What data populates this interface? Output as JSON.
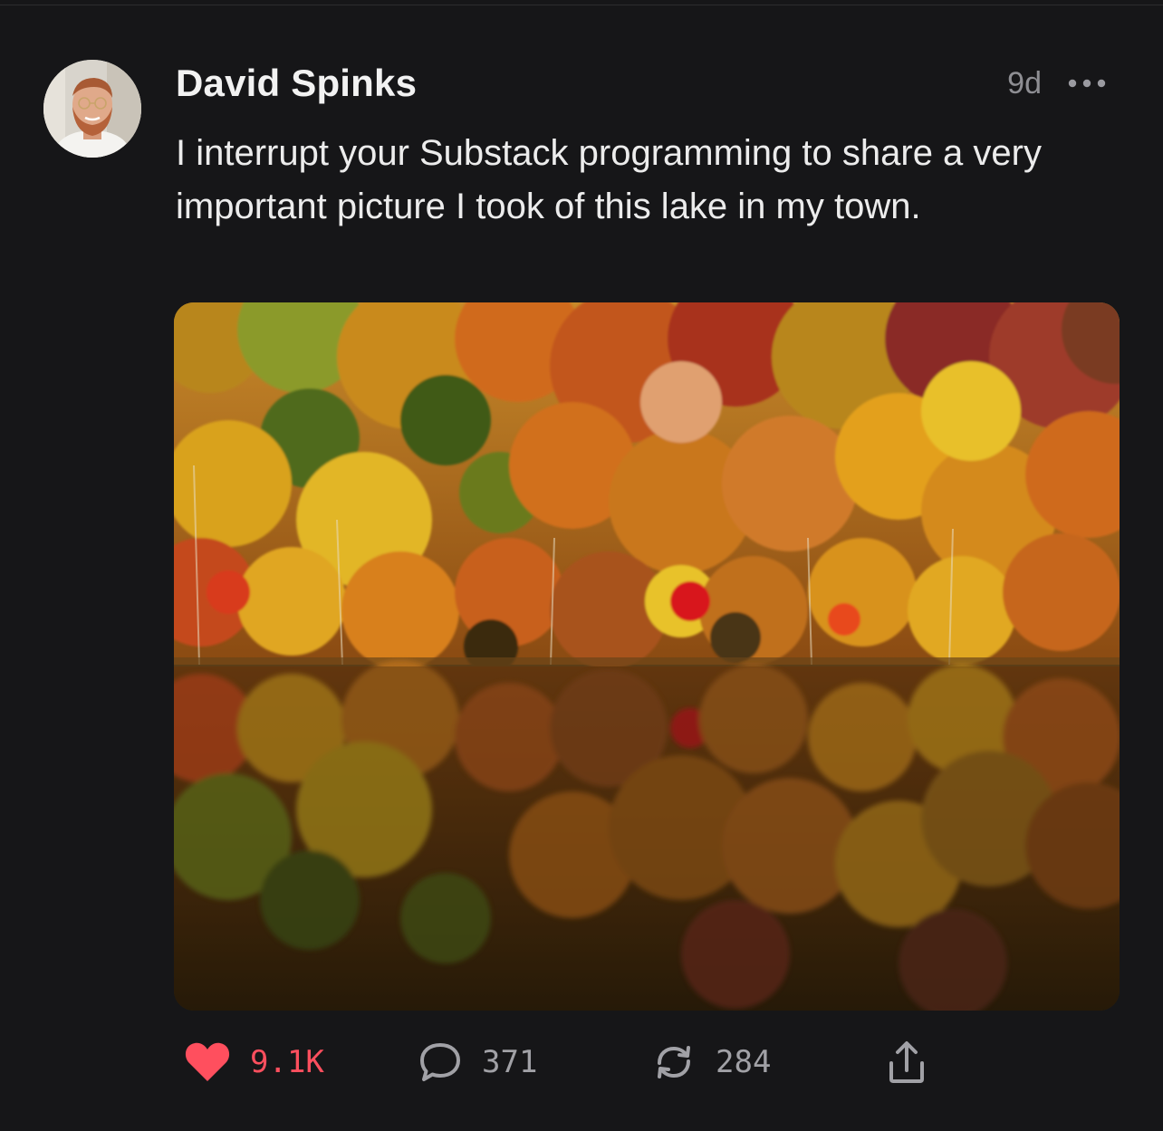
{
  "post": {
    "author_name": "David Spinks",
    "timestamp": "9d",
    "more_icon": "ellipsis-icon",
    "text": "I interrupt your Substack programming to share a very important picture I took of this lake in my town.",
    "image_alt": "Autumn trees with colorful foliage reflected in a lake"
  },
  "actions": {
    "like": {
      "icon": "heart-icon",
      "count": "9.1K",
      "color": "#ff4f5e",
      "liked": true
    },
    "comment": {
      "icon": "comment-icon",
      "count": "371"
    },
    "restack": {
      "icon": "restack-icon",
      "count": "284"
    },
    "share": {
      "icon": "share-icon"
    }
  },
  "colors": {
    "background": "#161618",
    "text_primary": "#ececec",
    "text_secondary": "#8e8e93",
    "like_red": "#ff4f5e"
  }
}
